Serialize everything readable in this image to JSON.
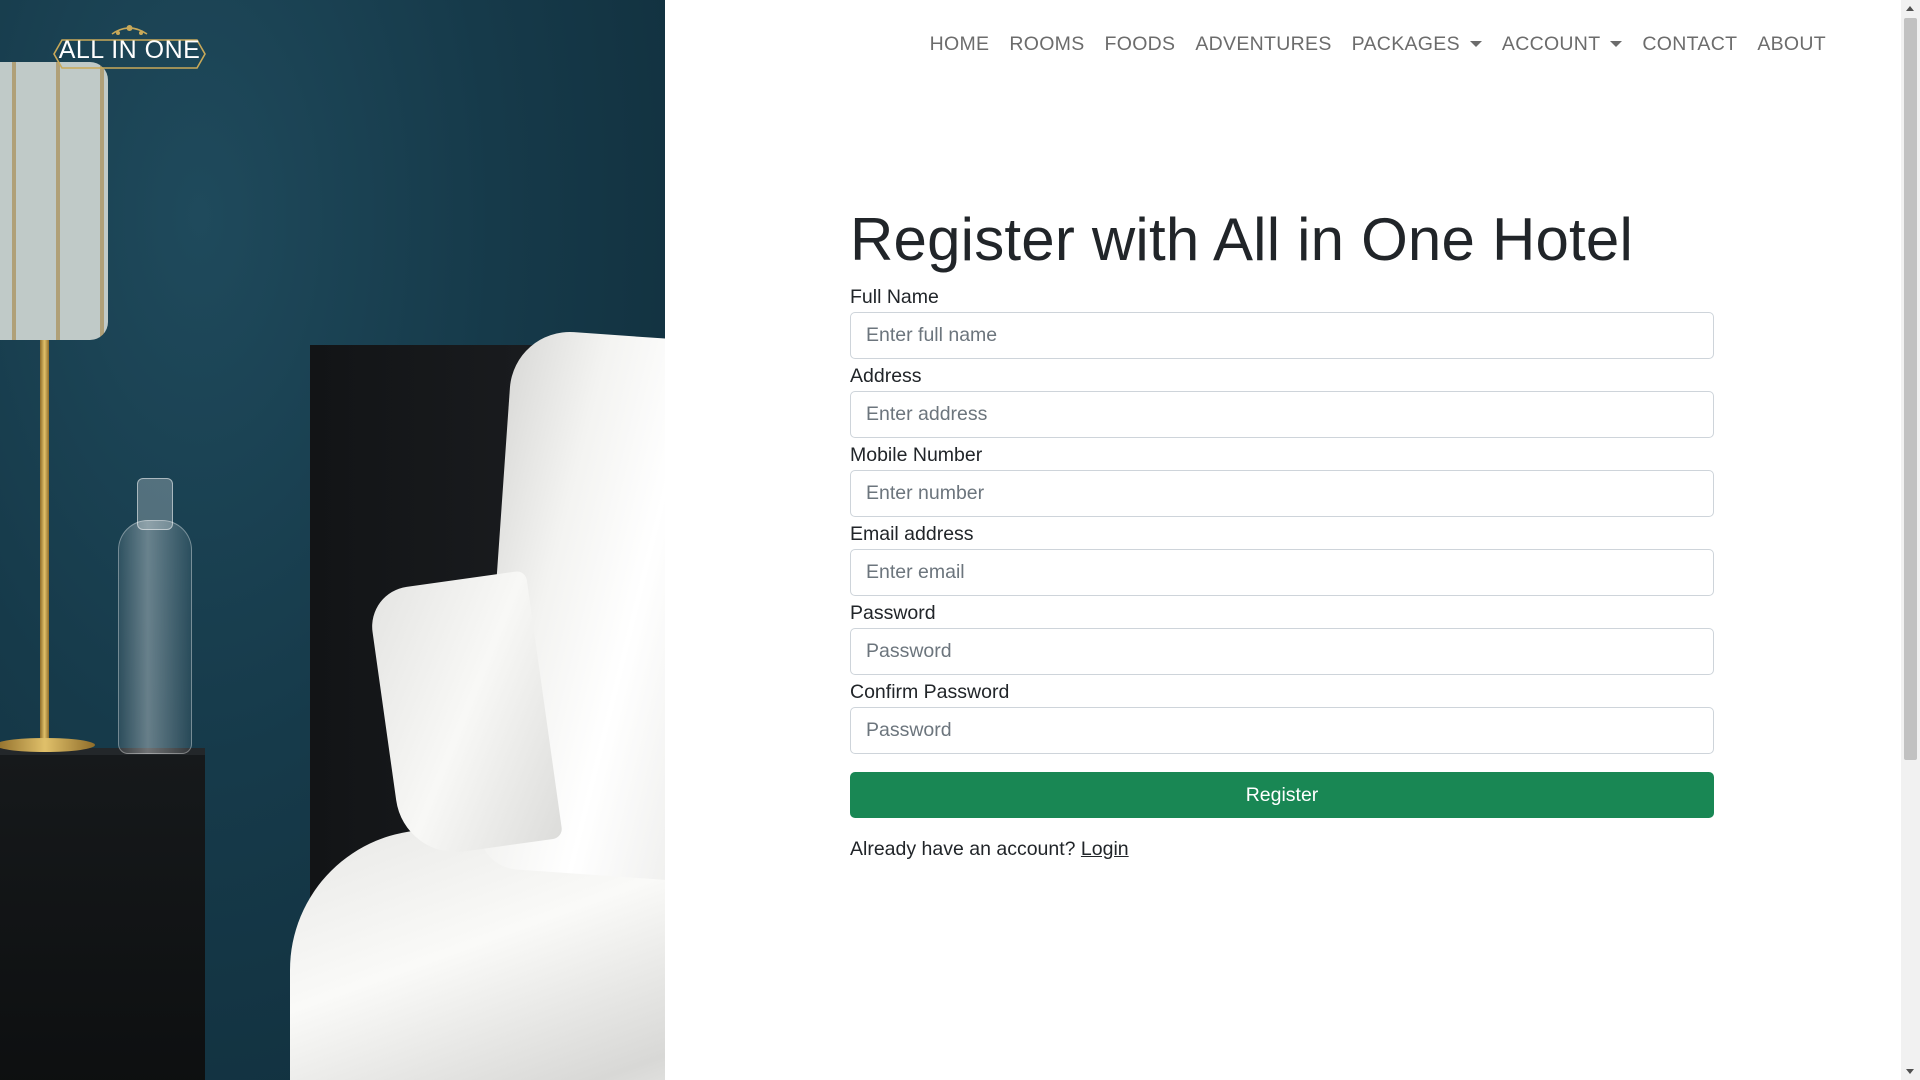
{
  "brand": {
    "logo_text": "ALL IN ONE"
  },
  "nav": {
    "items": [
      {
        "label": "HOME"
      },
      {
        "label": "ROOMS"
      },
      {
        "label": "FOODS"
      },
      {
        "label": "ADVENTURES"
      },
      {
        "label": "PACKAGES"
      },
      {
        "label": "ACCOUNT"
      },
      {
        "label": "CONTACT"
      },
      {
        "label": "ABOUT"
      }
    ]
  },
  "form": {
    "title": "Register with All in One Hotel",
    "fields": [
      {
        "label": "Full Name",
        "placeholder": "Enter full name",
        "value": ""
      },
      {
        "label": "Address",
        "placeholder": "Enter address",
        "value": ""
      },
      {
        "label": "Mobile Number",
        "placeholder": "Enter number",
        "value": ""
      },
      {
        "label": "Email address",
        "placeholder": "Enter email",
        "value": ""
      },
      {
        "label": "Password",
        "placeholder": "Password",
        "value": ""
      },
      {
        "label": "Confirm Password",
        "placeholder": "Password",
        "value": ""
      }
    ],
    "submit_label": "Register",
    "login_prompt": "Already have an account?",
    "login_link": "Login"
  },
  "colors": {
    "primary_button": "#198754",
    "nav_text": "#6c6c6c",
    "hero_wall": "#163a4a"
  },
  "icons": {
    "dropdown": "chevron-down-icon"
  }
}
